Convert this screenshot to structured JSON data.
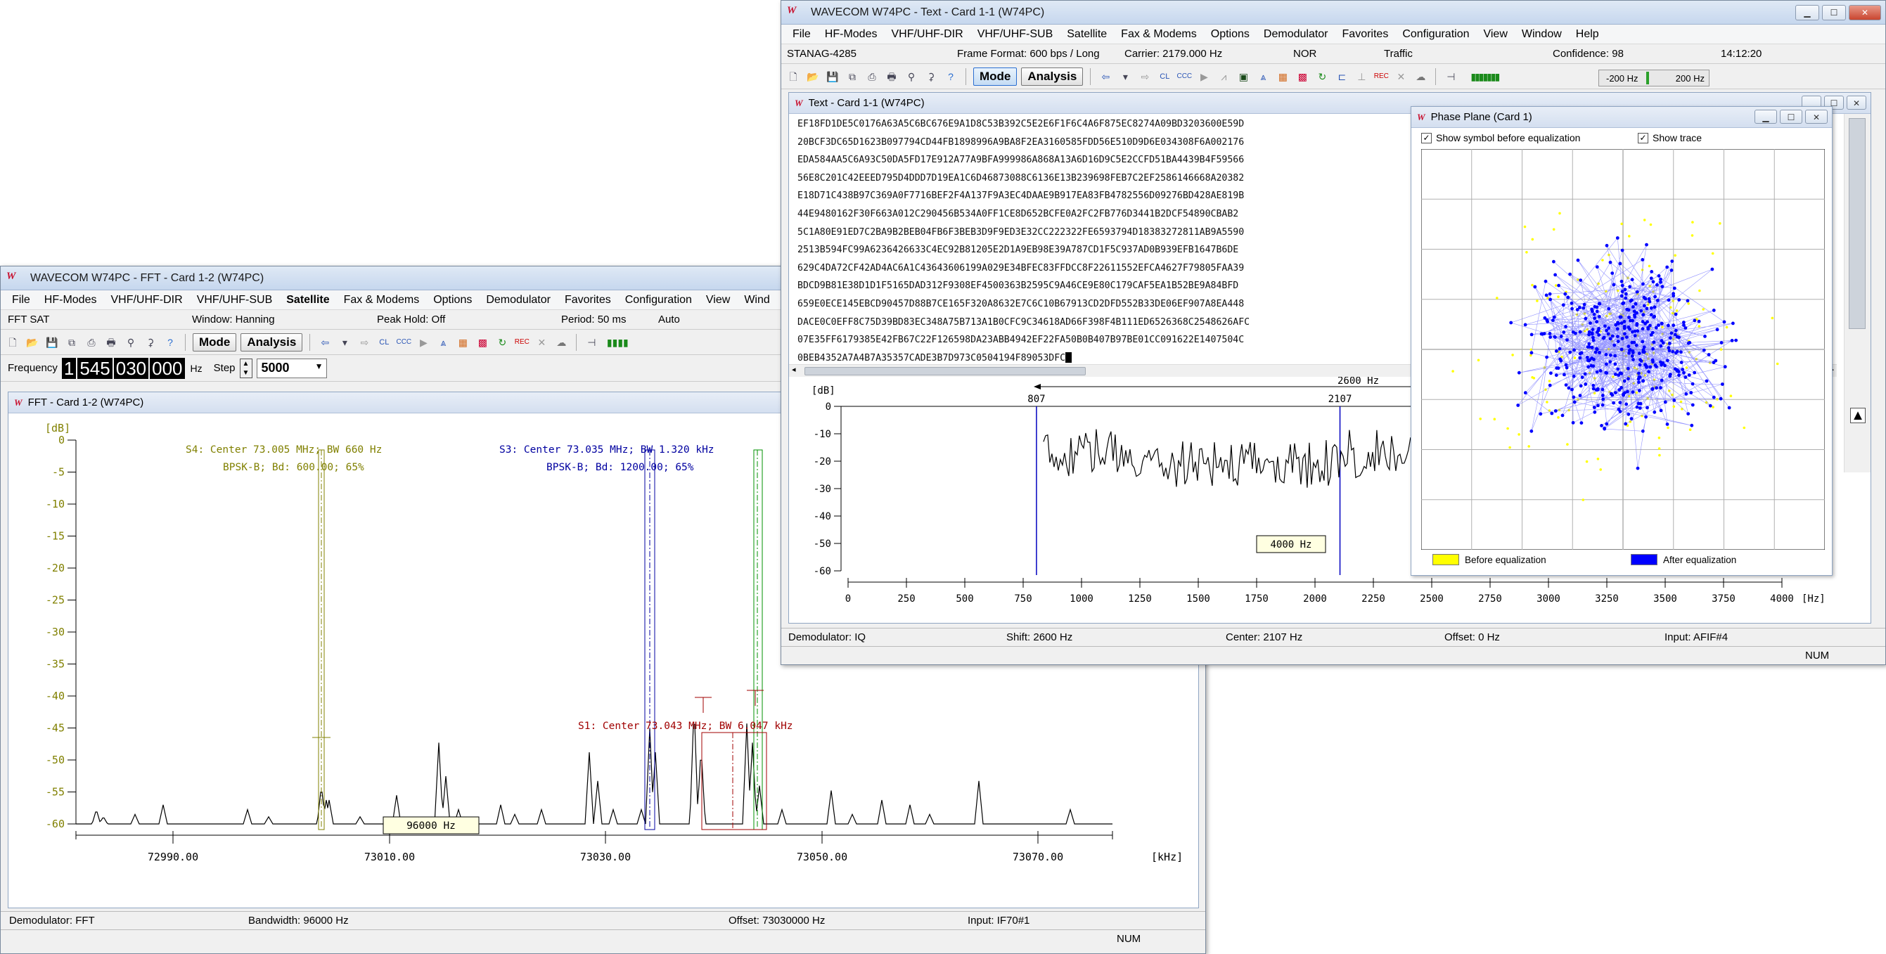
{
  "fft_window": {
    "title": "WAVECOM W74PC - FFT  - Card 1-2 (W74PC)",
    "menu": [
      "File",
      "HF-Modes",
      "VHF/UHF-DIR",
      "VHF/UHF-SUB",
      "Satellite",
      "Fax & Modems",
      "Options",
      "Demodulator",
      "Favorites",
      "Configuration",
      "View",
      "Wind"
    ],
    "menu_bold": "Satellite",
    "info": {
      "mode": "FFT SAT",
      "window": "Window: Hanning",
      "peak": "Peak Hold: Off",
      "period": "Period: 50 ms",
      "auto": "Auto"
    },
    "toolbar": {
      "mode_label": "Mode",
      "analysis_label": "Analysis"
    },
    "frequency_label": "Frequency",
    "frequency_digits": [
      "1",
      "545",
      "030",
      "000"
    ],
    "frequency_unit": "Hz",
    "step_label": "Step",
    "step_value": "5000",
    "mdi_title": "FFT  - Card 1-2 (W74PC)",
    "plot": {
      "ylabel": "[dB]",
      "yticks": [
        "0",
        "-5",
        "-10",
        "-15",
        "-20",
        "-25",
        "-30",
        "-35",
        "-40",
        "-45",
        "-50",
        "-55",
        "-60"
      ],
      "xticks": [
        "72990.00",
        "73010.00",
        "73030.00",
        "73050.00",
        "73070.00"
      ],
      "xunit": "[kHz]",
      "s4_line1": "S4: Center 73.005 MHz; BW 660 Hz",
      "s4_line2": "BPSK-B; Bd: 600.00; 65%",
      "s3_line1": "S3: Center 73.035 MHz; BW 1.320 kHz",
      "s3_line2": "BPSK-B; Bd: 1200.00; 65%",
      "s1_label": "S1: Center 73.043 MHz; BW 6.047 kHz",
      "bw_label": "96000 Hz"
    },
    "status": {
      "demod": "Demodulator: FFT",
      "bandwidth": "Bandwidth: 96000 Hz",
      "offset": "Offset: 73030000 Hz",
      "input": "Input: IF70#1",
      "num": "NUM"
    }
  },
  "text_window": {
    "title": "WAVECOM W74PC - Text  - Card 1-1 (W74PC)",
    "menu": [
      "File",
      "HF-Modes",
      "VHF/UHF-DIR",
      "VHF/UHF-SUB",
      "Satellite",
      "Fax & Modems",
      "Options",
      "Demodulator",
      "Favorites",
      "Configuration",
      "View",
      "Window",
      "Help"
    ],
    "info": {
      "mode": "STANAG-4285",
      "frame": "Frame Format: 600 bps / Long",
      "carrier": "Carrier: 2179.000 Hz",
      "nor": "NOR",
      "traffic": "Traffic",
      "confidence": "Confidence: 98",
      "time": "14:12:20"
    },
    "toolbar": {
      "mode_label": "Mode",
      "analysis_label": "Analysis",
      "tuning_low": "-200 Hz",
      "tuning_high": "200 Hz"
    },
    "mdi_title": "Text  - Card 1-1 (W74PC)",
    "hex_lines": [
      "EF18FD1DE5C0176A63A5C6BC676E9A1D8C53B392C5E2E6F1F6C4A6F875EC8274A09BD3203600E59D",
      "20BCF3DC65D1623B097794CD44FB1898996A9BA8F2EA3160585FDD56E510D9D6E034308F6A002176",
      "EDA584AA5C6A93C50DA5FD17E912A77A9BFA999986A868A13A6D16D9C5E2CCFD51BA4439B4F59566",
      "56E8C201C42EEED795D4DDD7D19EA1C6D46873088C6136E13B239698FEB7C2EF2586146668A20382",
      "E18D71C438B97C369A0F7716BEF2F4A137F9A3EC4DAAE9B917EA83FB4782556D09276BD428AE819B",
      "44E9480162F30F663A012C290456B534A0FF1CE8D652BCFE0A2FC2FB776D3441B2DCF54890CBAB2",
      "5C1A80E91ED7C2BA9B2BEB04FB6F3BEB3D9F9ED3E32CC222322FE6593794D18383272811AB9A5590",
      "2513B594FC99A6236426633C4EC92B81205E2D1A9EB98E39A787CD1F5C937AD0B939EFB1647B6DE",
      "629C4DA72CF42AD4AC6A1C43643606199A029E34BFEC83FFDCC8F22611552EFCA4627F79805FAA39",
      "BDCD9B81E38D1D1F5165DAD312F9308EF4500363B2595C9A46CE9E80C179CAF5EA1B52BE9A84BFD",
      "659E0ECE145EBCD90457D88B7CE165F320A8632E7C6C10B67913CD2DFD552B33DE06EF907A8EA448",
      "DACE0C0EFF8C75D39BD83EC348A75B713A1B0CFC9C34618AD66F398F4B111ED6526368C2548626AFC",
      "07E35FF6179385E42FB67C22F126598DA23ABB4942EF22FA50B0B407B97BE01CC091622E1407504C",
      "0BEB4352A7A4B7A35357CADE3B7D973C0504194F89053DFC"
    ],
    "spectrum": {
      "ylabel": "[dB]",
      "yticks": [
        "0",
        "-10",
        "-20",
        "-30",
        "-40",
        "-50",
        "-60"
      ],
      "xticks": [
        "0",
        "250",
        "500",
        "750",
        "1000",
        "1250",
        "1500",
        "1750",
        "2000",
        "2250",
        "2500",
        "2750",
        "3000",
        "3250",
        "3500",
        "3750",
        "4000"
      ],
      "xunit": "[Hz]",
      "shift_label": "2600 Hz",
      "marker_low": "807",
      "marker_high": "2107",
      "bw_label": "4000 Hz"
    },
    "phase_plane": {
      "title": "Phase Plane (Card 1)",
      "show_symbol_label": "Show symbol before equalization",
      "show_trace_label": "Show trace",
      "legend_before": "Before equalization",
      "legend_after": "After equalization",
      "color_before": "#ffff00",
      "color_after": "#0000ff"
    },
    "status": {
      "demod": "Demodulator: IQ",
      "shift": "Shift: 2600 Hz",
      "center": "Center: 2107 Hz",
      "offset": "Offset: 0 Hz",
      "input": "Input: AFIF#4",
      "num": "NUM"
    }
  }
}
